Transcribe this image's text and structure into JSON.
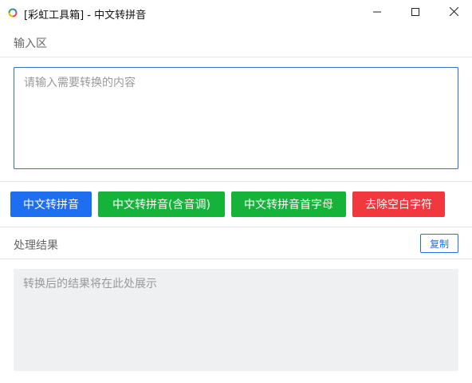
{
  "window": {
    "title": "[彩虹工具箱] - 中文转拼音",
    "icon": "rainbow-ring-icon",
    "controls": [
      "minimize-icon",
      "maximize-icon",
      "close-icon"
    ]
  },
  "input_section": {
    "label": "输入区",
    "placeholder": "请输入需要转换的内容",
    "value": ""
  },
  "actions": {
    "to_pinyin": "中文转拼音",
    "to_pinyin_tone": "中文转拼音(含音调)",
    "to_pinyin_initials": "中文转拼音首字母",
    "remove_whitespace": "去除空白字符"
  },
  "result_section": {
    "label": "处理结果",
    "copy_label": "复制",
    "placeholder": "转换后的结果将在此处展示",
    "value": ""
  },
  "colors": {
    "primary_blue": "#1e6ff0",
    "success_green": "#16b33a",
    "danger_red": "#f0383e",
    "input_border": "#2f6fd0",
    "result_bg": "#eef0f2"
  }
}
